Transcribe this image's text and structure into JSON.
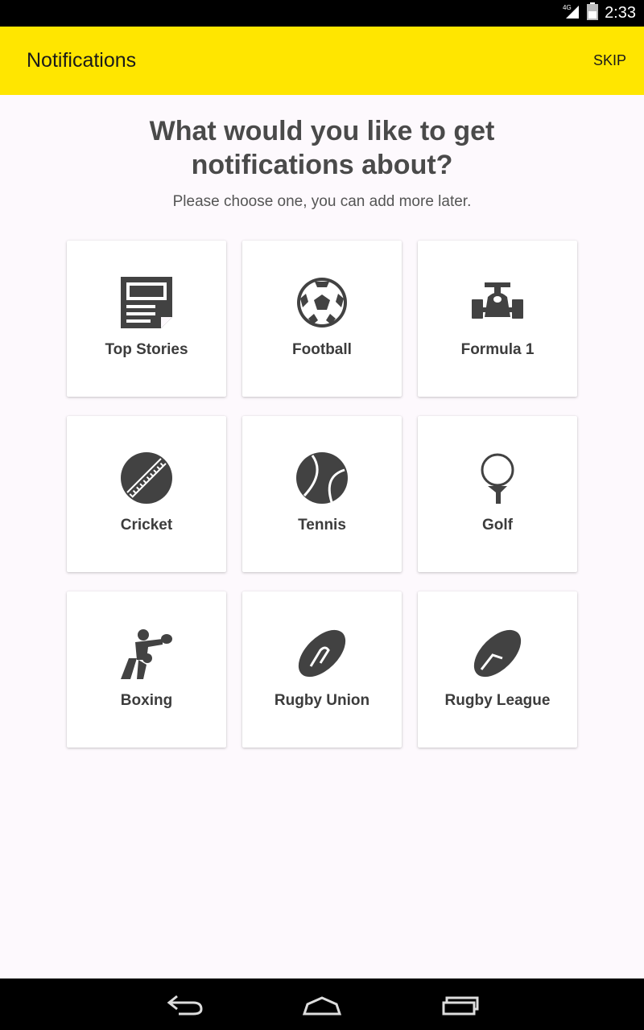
{
  "status_bar": {
    "time": "2:33",
    "network": "4G"
  },
  "app_bar": {
    "title": "Notifications",
    "skip_label": "SKIP",
    "background": "#ffe600"
  },
  "heading": {
    "line1": "What would you like to get",
    "line2": "notifications about?"
  },
  "subheading": "Please choose one, you can add more later.",
  "topics": [
    {
      "label": "Top Stories",
      "icon": "newspaper-icon"
    },
    {
      "label": "Football",
      "icon": "football-icon"
    },
    {
      "label": "Formula 1",
      "icon": "formula1-car-icon"
    },
    {
      "label": "Cricket",
      "icon": "cricket-ball-icon"
    },
    {
      "label": "Tennis",
      "icon": "tennis-ball-icon"
    },
    {
      "label": "Golf",
      "icon": "golf-ball-icon"
    },
    {
      "label": "Boxing",
      "icon": "boxer-icon"
    },
    {
      "label": "Rugby Union",
      "icon": "rugby-union-ball-icon"
    },
    {
      "label": "Rugby League",
      "icon": "rugby-league-ball-icon"
    }
  ],
  "nav_bar": {
    "buttons": [
      "back",
      "home",
      "recents"
    ]
  }
}
